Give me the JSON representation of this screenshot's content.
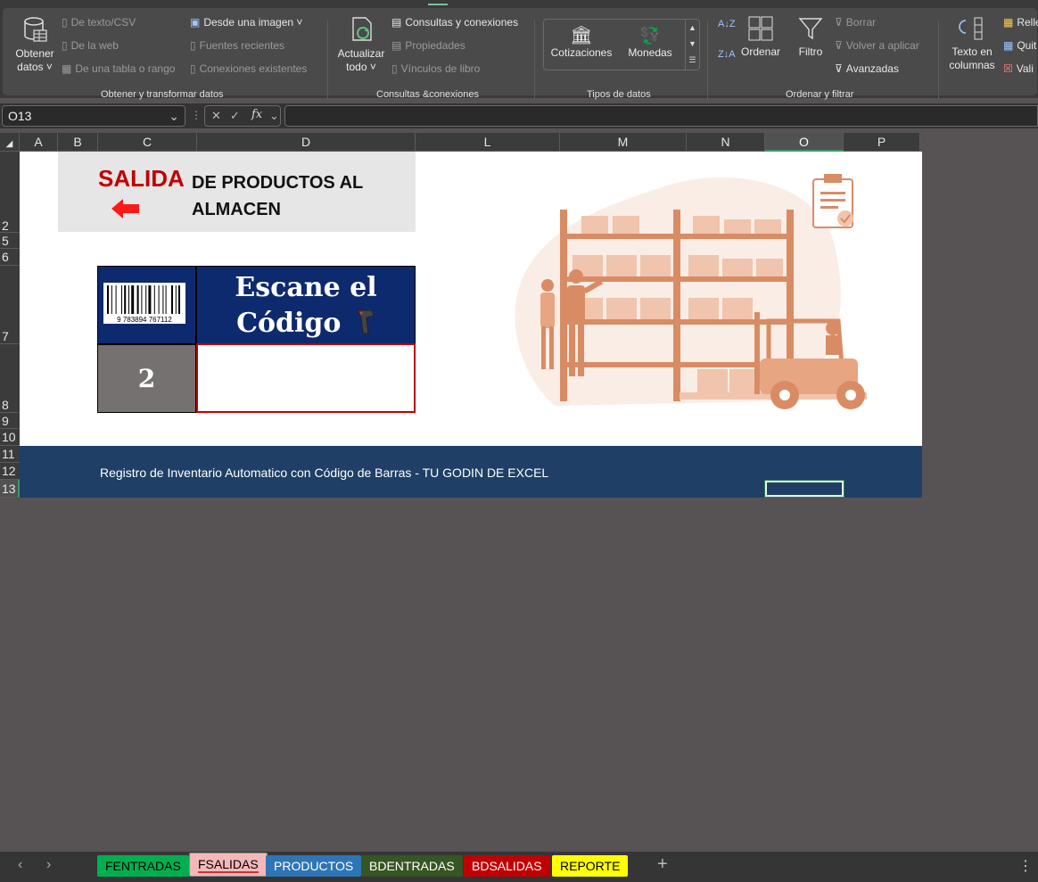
{
  "ribbon": {
    "groups": {
      "get_transform": "Obtener y transformar datos",
      "queries": "Consultas &conexiones",
      "data_types": "Tipos de datos",
      "sort_filter": "Ordenar y filtrar"
    },
    "get_data": {
      "line1": "Obtener",
      "line2": "datos ˅"
    },
    "from_text_csv": "De texto/CSV",
    "from_web": "De la web",
    "from_table": "De una tabla o rango",
    "from_image": "Desde una imagen ˅",
    "recent_sources": "Fuentes recientes",
    "existing_connections": "Conexiones existentes",
    "refresh_all": {
      "line1": "Actualizar",
      "line2": "todo ˅"
    },
    "queries_connections": "Consultas y conexiones",
    "properties": "Propiedades",
    "edit_links": "Vínculos de libro",
    "stocks": "Cotizaciones",
    "currencies": "Monedas",
    "sort_az": "A↓Z",
    "sort_za": "Z↓A",
    "sort": "Ordenar",
    "filter": "Filtro",
    "clear": "Borrar",
    "reapply": "Volver a aplicar",
    "advanced": "Avanzadas",
    "text_to_columns": {
      "line1": "Texto en",
      "line2": "columnas"
    },
    "flash_fill": "Relle",
    "remove_duplicates": "Quit",
    "data_validation": "Vali"
  },
  "formula_bar": {
    "name_box": "O13",
    "fx": "fx",
    "formula": ""
  },
  "columns": [
    "A",
    "B",
    "C",
    "D",
    "L",
    "M",
    "N",
    "O",
    "P"
  ],
  "rows": [
    "2",
    "5",
    "6",
    "7",
    "8",
    "9",
    "10",
    "11",
    "12",
    "13"
  ],
  "sheet": {
    "title_red": "SALIDA",
    "title_rest": "DE PRODUCTOS AL ALMACEN",
    "barcode_digits": "9 783894 767112",
    "scan_title_line1": "Escane el",
    "scan_title_line2": "Código",
    "scan_count": "2",
    "scan_input_value": "",
    "footer_text": "Registro de Inventario Automatico con Código de Barras - TU GODIN DE EXCEL"
  },
  "sheet_tabs": [
    {
      "label": "FENTRADAS",
      "color": "#00b050"
    },
    {
      "label": "FSALIDAS",
      "color": "#f4b8b8",
      "active": true
    },
    {
      "label": "PRODUCTOS",
      "color": "#2e75b6"
    },
    {
      "label": "BDENTRADAS",
      "color": "#375623"
    },
    {
      "label": "BDSALIDAS",
      "color": "#c00000"
    },
    {
      "label": "REPORTE",
      "color": "#ffff00"
    }
  ],
  "colors": {
    "accent_red": "#c00000",
    "navy": "#0e2a6e",
    "footer_blue": "#1f3f66",
    "illustration": "#d98c64"
  }
}
